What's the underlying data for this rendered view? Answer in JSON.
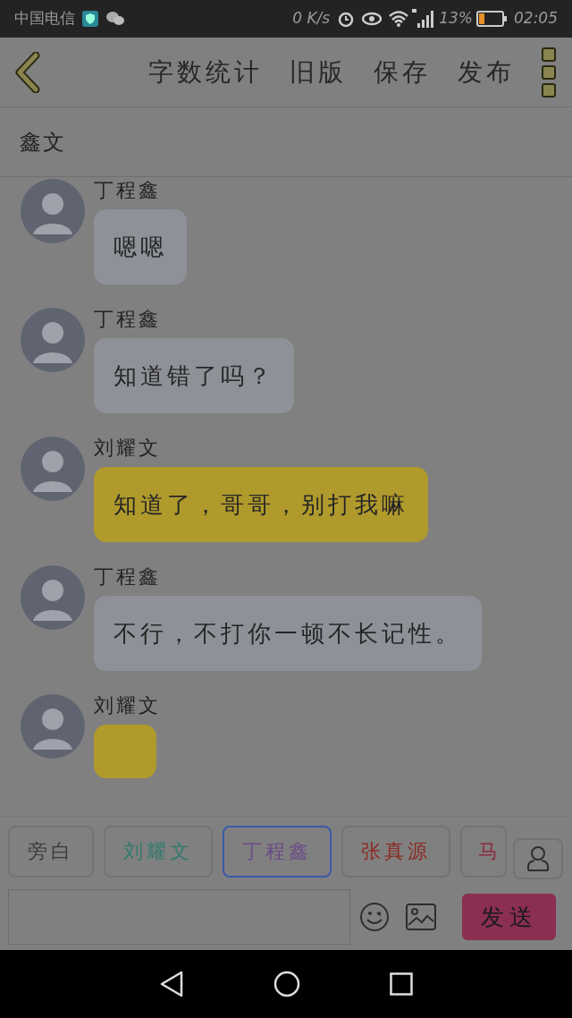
{
  "status_bar": {
    "carrier": "中国电信",
    "speed": "0 K/s",
    "battery": "13%",
    "time": "02:05"
  },
  "toolbar": {
    "actions": [
      "字数统计",
      "旧版",
      "保存",
      "发布"
    ]
  },
  "title": "鑫文",
  "messages": [
    {
      "speaker": "丁程鑫",
      "text": "嗯嗯",
      "color": "#8e9198"
    },
    {
      "speaker": "丁程鑫",
      "text": "知道错了吗？",
      "color": "#8e9198"
    },
    {
      "speaker": "刘耀文",
      "text": "知道了，哥哥，别打我嘛",
      "color": "#b09a2c"
    },
    {
      "speaker": "丁程鑫",
      "text": "不行，不打你一顿不长记性。",
      "color": "#8e9198"
    },
    {
      "speaker": "刘耀文",
      "color": "#b09a2c"
    }
  ],
  "characters": [
    {
      "name": "旁白",
      "color": "#3a3a3a",
      "selected": false
    },
    {
      "name": "刘耀文",
      "color": "#2f7a6c",
      "selected": false
    },
    {
      "name": "丁程鑫",
      "color": "#6a4a86",
      "selected": true
    },
    {
      "name": "张真源",
      "color": "#8a2a22",
      "selected": false
    },
    {
      "name": "马",
      "color": "#8a2a3c",
      "selected": false
    }
  ],
  "send_button": "发送"
}
